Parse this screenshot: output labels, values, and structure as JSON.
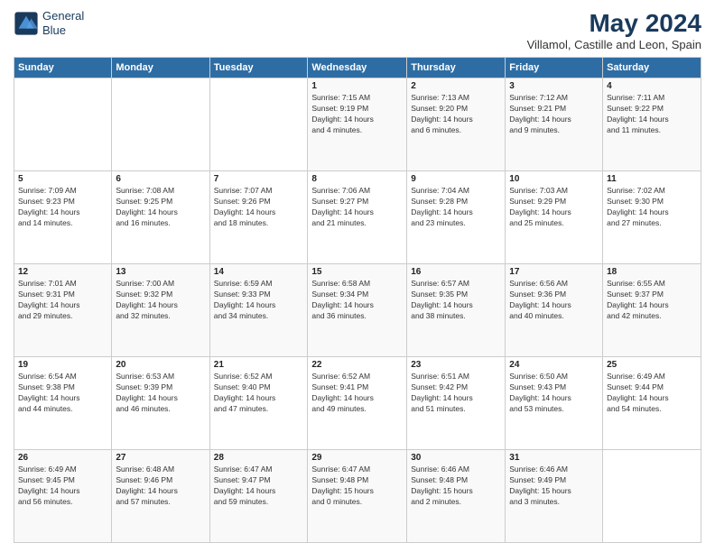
{
  "header": {
    "logo_line1": "General",
    "logo_line2": "Blue",
    "title": "May 2024",
    "subtitle": "Villamol, Castille and Leon, Spain"
  },
  "weekdays": [
    "Sunday",
    "Monday",
    "Tuesday",
    "Wednesday",
    "Thursday",
    "Friday",
    "Saturday"
  ],
  "weeks": [
    [
      {
        "day": "",
        "info": ""
      },
      {
        "day": "",
        "info": ""
      },
      {
        "day": "",
        "info": ""
      },
      {
        "day": "1",
        "info": "Sunrise: 7:15 AM\nSunset: 9:19 PM\nDaylight: 14 hours\nand 4 minutes."
      },
      {
        "day": "2",
        "info": "Sunrise: 7:13 AM\nSunset: 9:20 PM\nDaylight: 14 hours\nand 6 minutes."
      },
      {
        "day": "3",
        "info": "Sunrise: 7:12 AM\nSunset: 9:21 PM\nDaylight: 14 hours\nand 9 minutes."
      },
      {
        "day": "4",
        "info": "Sunrise: 7:11 AM\nSunset: 9:22 PM\nDaylight: 14 hours\nand 11 minutes."
      }
    ],
    [
      {
        "day": "5",
        "info": "Sunrise: 7:09 AM\nSunset: 9:23 PM\nDaylight: 14 hours\nand 14 minutes."
      },
      {
        "day": "6",
        "info": "Sunrise: 7:08 AM\nSunset: 9:25 PM\nDaylight: 14 hours\nand 16 minutes."
      },
      {
        "day": "7",
        "info": "Sunrise: 7:07 AM\nSunset: 9:26 PM\nDaylight: 14 hours\nand 18 minutes."
      },
      {
        "day": "8",
        "info": "Sunrise: 7:06 AM\nSunset: 9:27 PM\nDaylight: 14 hours\nand 21 minutes."
      },
      {
        "day": "9",
        "info": "Sunrise: 7:04 AM\nSunset: 9:28 PM\nDaylight: 14 hours\nand 23 minutes."
      },
      {
        "day": "10",
        "info": "Sunrise: 7:03 AM\nSunset: 9:29 PM\nDaylight: 14 hours\nand 25 minutes."
      },
      {
        "day": "11",
        "info": "Sunrise: 7:02 AM\nSunset: 9:30 PM\nDaylight: 14 hours\nand 27 minutes."
      }
    ],
    [
      {
        "day": "12",
        "info": "Sunrise: 7:01 AM\nSunset: 9:31 PM\nDaylight: 14 hours\nand 29 minutes."
      },
      {
        "day": "13",
        "info": "Sunrise: 7:00 AM\nSunset: 9:32 PM\nDaylight: 14 hours\nand 32 minutes."
      },
      {
        "day": "14",
        "info": "Sunrise: 6:59 AM\nSunset: 9:33 PM\nDaylight: 14 hours\nand 34 minutes."
      },
      {
        "day": "15",
        "info": "Sunrise: 6:58 AM\nSunset: 9:34 PM\nDaylight: 14 hours\nand 36 minutes."
      },
      {
        "day": "16",
        "info": "Sunrise: 6:57 AM\nSunset: 9:35 PM\nDaylight: 14 hours\nand 38 minutes."
      },
      {
        "day": "17",
        "info": "Sunrise: 6:56 AM\nSunset: 9:36 PM\nDaylight: 14 hours\nand 40 minutes."
      },
      {
        "day": "18",
        "info": "Sunrise: 6:55 AM\nSunset: 9:37 PM\nDaylight: 14 hours\nand 42 minutes."
      }
    ],
    [
      {
        "day": "19",
        "info": "Sunrise: 6:54 AM\nSunset: 9:38 PM\nDaylight: 14 hours\nand 44 minutes."
      },
      {
        "day": "20",
        "info": "Sunrise: 6:53 AM\nSunset: 9:39 PM\nDaylight: 14 hours\nand 46 minutes."
      },
      {
        "day": "21",
        "info": "Sunrise: 6:52 AM\nSunset: 9:40 PM\nDaylight: 14 hours\nand 47 minutes."
      },
      {
        "day": "22",
        "info": "Sunrise: 6:52 AM\nSunset: 9:41 PM\nDaylight: 14 hours\nand 49 minutes."
      },
      {
        "day": "23",
        "info": "Sunrise: 6:51 AM\nSunset: 9:42 PM\nDaylight: 14 hours\nand 51 minutes."
      },
      {
        "day": "24",
        "info": "Sunrise: 6:50 AM\nSunset: 9:43 PM\nDaylight: 14 hours\nand 53 minutes."
      },
      {
        "day": "25",
        "info": "Sunrise: 6:49 AM\nSunset: 9:44 PM\nDaylight: 14 hours\nand 54 minutes."
      }
    ],
    [
      {
        "day": "26",
        "info": "Sunrise: 6:49 AM\nSunset: 9:45 PM\nDaylight: 14 hours\nand 56 minutes."
      },
      {
        "day": "27",
        "info": "Sunrise: 6:48 AM\nSunset: 9:46 PM\nDaylight: 14 hours\nand 57 minutes."
      },
      {
        "day": "28",
        "info": "Sunrise: 6:47 AM\nSunset: 9:47 PM\nDaylight: 14 hours\nand 59 minutes."
      },
      {
        "day": "29",
        "info": "Sunrise: 6:47 AM\nSunset: 9:48 PM\nDaylight: 15 hours\nand 0 minutes."
      },
      {
        "day": "30",
        "info": "Sunrise: 6:46 AM\nSunset: 9:48 PM\nDaylight: 15 hours\nand 2 minutes."
      },
      {
        "day": "31",
        "info": "Sunrise: 6:46 AM\nSunset: 9:49 PM\nDaylight: 15 hours\nand 3 minutes."
      },
      {
        "day": "",
        "info": ""
      }
    ]
  ]
}
